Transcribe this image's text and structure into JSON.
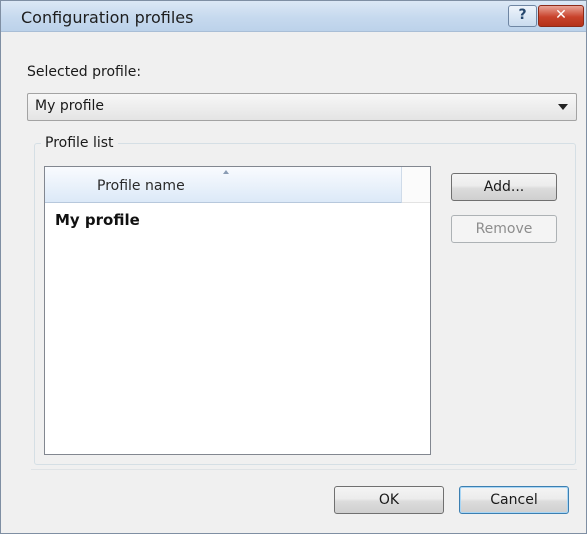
{
  "window": {
    "title": "Configuration profiles",
    "help_glyph": "?",
    "close_glyph": "✕"
  },
  "selected_profile": {
    "label": "Selected profile:",
    "value": "My profile"
  },
  "profile_list": {
    "group_title": "Profile list",
    "column_header": "Profile name",
    "rows": [
      "My profile"
    ]
  },
  "buttons": {
    "add": "Add...",
    "remove": "Remove",
    "ok": "OK",
    "cancel": "Cancel"
  },
  "icons": {
    "help": "question-mark-icon",
    "close": "close-icon",
    "dropdown": "chevron-down-icon",
    "sort": "sort-ascending-icon"
  },
  "colors": {
    "titlebar": "#c6d9ee",
    "close_button": "#c8422b",
    "dialog_background": "#f0f0f0"
  }
}
